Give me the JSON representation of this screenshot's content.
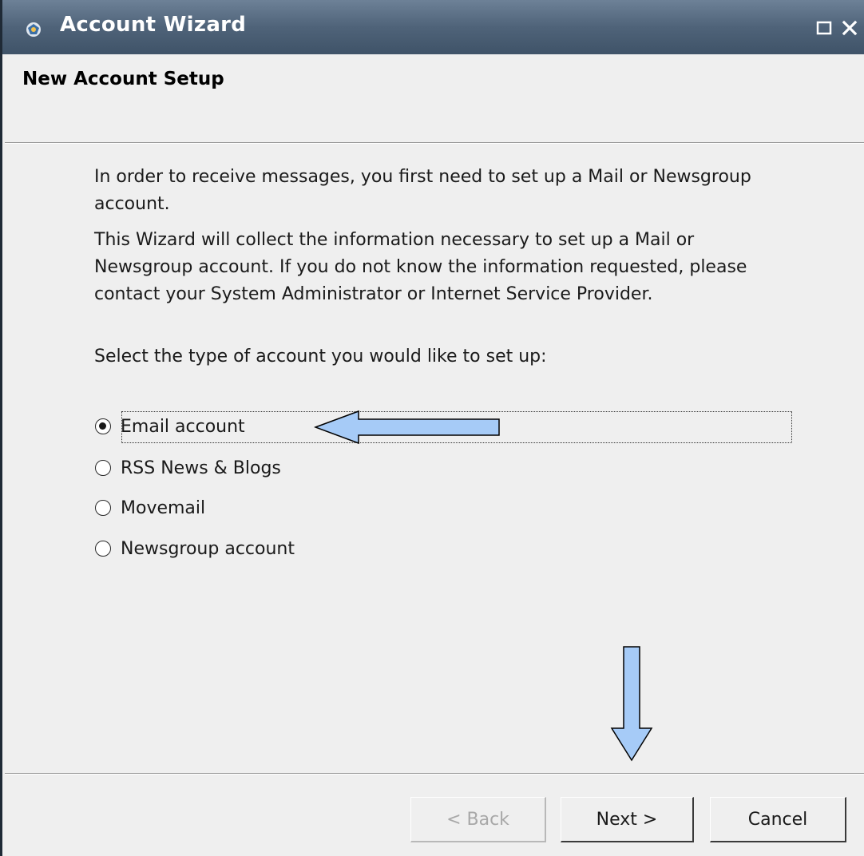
{
  "window": {
    "title": "Account Wizard",
    "icon": "app-icon",
    "controls": {
      "maximize_icon": "maximize-icon",
      "close_icon": "close-icon"
    }
  },
  "header": {
    "title": "New Account Setup"
  },
  "body": {
    "paragraph1": "In order to receive messages, you first need to set up a Mail or Newsgroup account.",
    "paragraph2": "This Wizard will collect the information necessary to set up a Mail or Newsgroup account. If you do not know the information requested, please contact your System Administrator or Internet Service Provider.",
    "prompt": "Select the type of account you would like to set up:"
  },
  "account_types": {
    "selected": "Email account",
    "options": [
      {
        "label": "Email account",
        "checked": true
      },
      {
        "label": "RSS News & Blogs",
        "checked": false
      },
      {
        "label": "Movemail",
        "checked": false
      },
      {
        "label": "Newsgroup account",
        "checked": false
      }
    ]
  },
  "footer": {
    "back_label": "< Back",
    "back_enabled": false,
    "next_label": "Next >",
    "cancel_label": "Cancel"
  },
  "colors": {
    "titlebar": "#4f6379",
    "annotation_arrow_fill": "#a6cbf7",
    "annotation_arrow_stroke": "#000000"
  }
}
